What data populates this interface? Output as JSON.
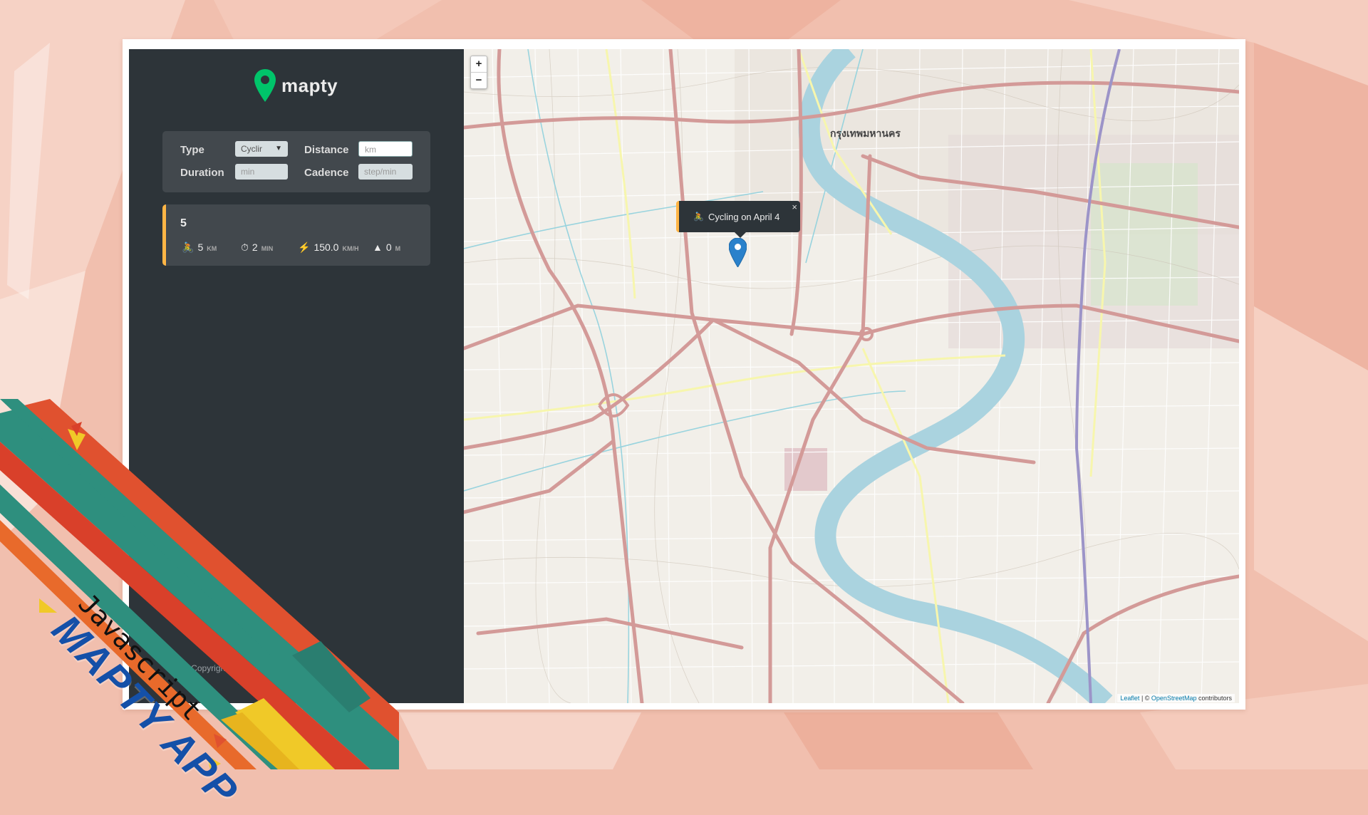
{
  "colors": {
    "background": "#f1bfae",
    "sidebar": "#2d3439",
    "panel": "#42484d",
    "accent_cycling": "#ffb545",
    "logo_green": "#00c46a",
    "title_blue": "#1450a8"
  },
  "app": {
    "logo_text": "mapty",
    "logo_icon": "map-pin-icon"
  },
  "form": {
    "type_label": "Type",
    "type_value": "Cyclir",
    "distance_label": "Distance",
    "distance_placeholder": "km",
    "duration_label": "Duration",
    "duration_placeholder": "min",
    "cadence_label": "Cadence",
    "cadence_placeholder": "step/min"
  },
  "workout": {
    "title": "5",
    "distance_icon": "cyclist-icon",
    "distance_value": "5",
    "distance_unit": "km",
    "duration_icon": "stopwatch-icon",
    "duration_value": "2",
    "duration_unit": "min",
    "speed_icon": "lightning-icon",
    "speed_value": "150.0",
    "speed_unit": "km/h",
    "elevation_icon": "mountain-icon",
    "elevation_value": "0",
    "elevation_unit": "m"
  },
  "footer": {
    "copyright": "© Copyright.                          Use for My portfolio."
  },
  "map": {
    "zoom_in": "+",
    "zoom_out": "−",
    "popup_text": "Cycling on April 4",
    "popup_close": "×",
    "area_label": "กรุงเทพมหานคร",
    "attribution_leaflet": "Leaflet",
    "attribution_sep": " | © ",
    "attribution_osm": "OpenStreetMap",
    "attribution_tail": " contributors"
  },
  "branding": {
    "title": "MAPTY APP",
    "subtitle": "Javascript"
  }
}
